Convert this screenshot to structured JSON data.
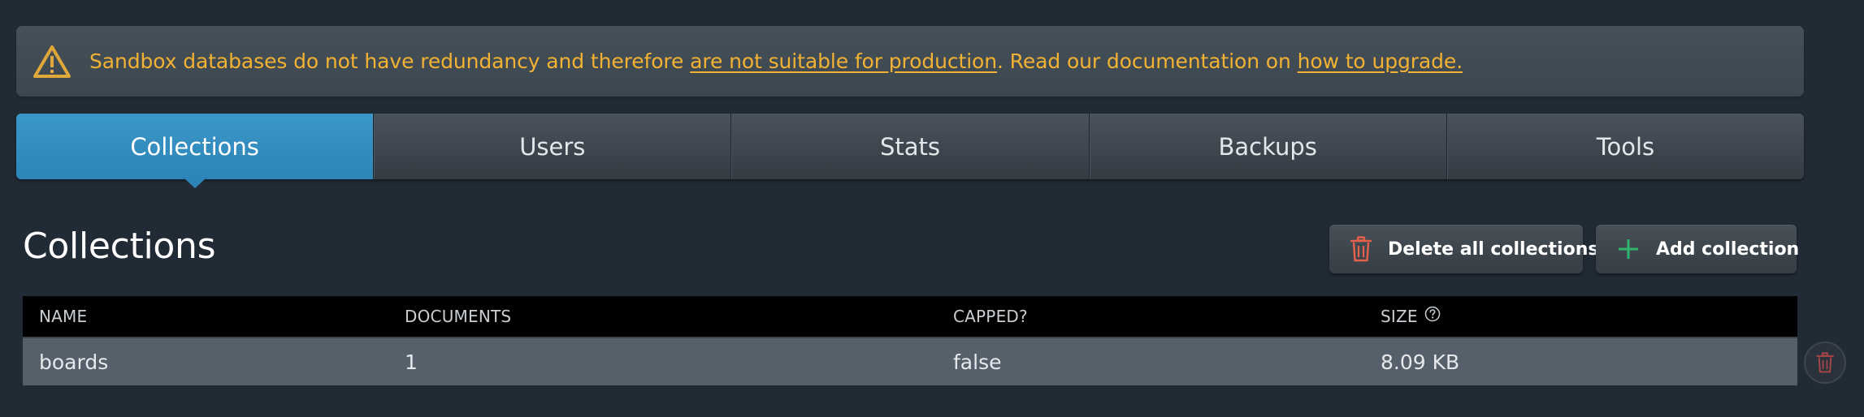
{
  "banner": {
    "prefix": "Sandbox databases do not have redundancy and therefore ",
    "link1": "are not suitable for production",
    "middle": ". Read our documentation on ",
    "link2": "how to upgrade.",
    "icon": "warning-triangle-icon",
    "color": "#f2b233"
  },
  "tabs": [
    {
      "label": "Collections",
      "active": true
    },
    {
      "label": "Users",
      "active": false
    },
    {
      "label": "Stats",
      "active": false
    },
    {
      "label": "Backups",
      "active": false
    },
    {
      "label": "Tools",
      "active": false
    }
  ],
  "section": {
    "title": "Collections"
  },
  "actions": {
    "delete_all_label": "Delete all collections",
    "delete_all_icon": "trash-icon",
    "add_label": "Add collection",
    "add_icon": "plus-icon"
  },
  "table": {
    "headers": {
      "name": "NAME",
      "documents": "DOCUMENTS",
      "capped": "CAPPED?",
      "size": "SIZE"
    },
    "rows": [
      {
        "name": "boards",
        "documents": "1",
        "capped": "false",
        "size": "8.09 KB"
      }
    ]
  },
  "colors": {
    "background": "#212b36",
    "active_tab": "#2d84b6",
    "delete_icon": "#e8604c",
    "add_icon": "#2fb46e"
  }
}
